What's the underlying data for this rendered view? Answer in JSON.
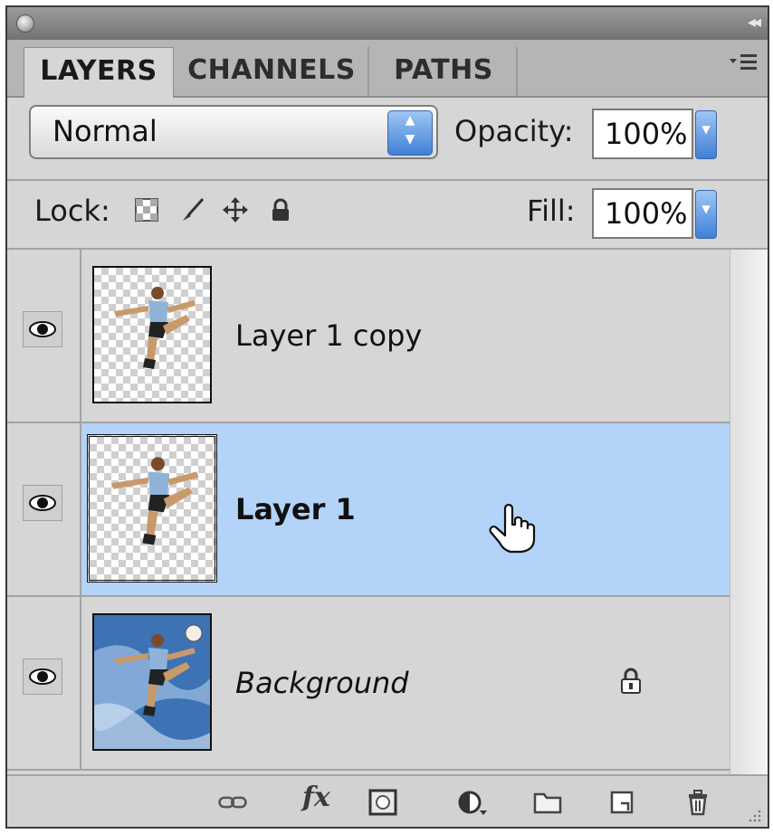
{
  "tabs": [
    {
      "label": "LAYERS",
      "active": true
    },
    {
      "label": "CHANNELS",
      "active": false
    },
    {
      "label": "PATHS",
      "active": false
    }
  ],
  "blend_mode": {
    "value": "Normal"
  },
  "opacity": {
    "label": "Opacity:",
    "value": "100%"
  },
  "lock": {
    "label": "Lock:",
    "icons": [
      "lock-transparency-icon",
      "lock-paint-icon",
      "lock-move-icon",
      "lock-all-icon"
    ]
  },
  "fill": {
    "label": "Fill:",
    "value": "100%"
  },
  "layers": [
    {
      "name": "Layer 1 copy",
      "visible": true,
      "selected": false,
      "locked": false
    },
    {
      "name": "Layer 1",
      "visible": true,
      "selected": true,
      "locked": false
    },
    {
      "name": "Background",
      "visible": true,
      "selected": false,
      "locked": true
    }
  ],
  "bottom_icons": [
    "link-layers-icon",
    "fx-icon",
    "layer-mask-icon",
    "adjustment-layer-icon",
    "new-group-icon",
    "new-layer-icon",
    "trash-icon"
  ],
  "fx_text": "fx",
  "colors": {
    "panel": "#d6d6d6",
    "selected_row": "#b3d3f8",
    "accent_button": "#3f80d6"
  }
}
